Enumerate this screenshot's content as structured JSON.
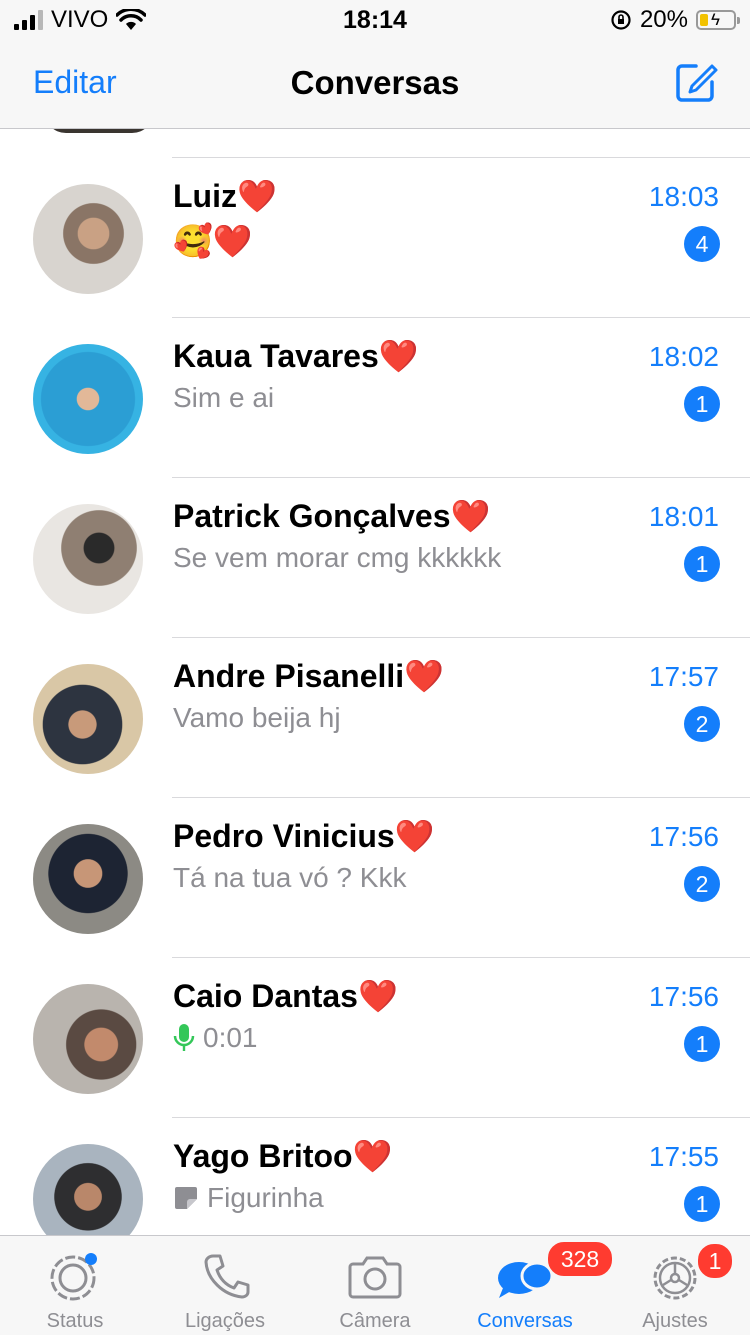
{
  "status_bar": {
    "carrier": "VIVO",
    "time": "18:14",
    "battery": "20%"
  },
  "nav": {
    "edit": "Editar",
    "title": "Conversas"
  },
  "chats": [
    {
      "name": "Luiz❤️",
      "time": "18:03",
      "preview": "🥰❤️",
      "badge": "4",
      "preview_type": "emoji"
    },
    {
      "name": "Kaua Tavares❤️",
      "time": "18:02",
      "preview": "Sim e ai",
      "badge": "1",
      "preview_type": "text"
    },
    {
      "name": "Patrick Gonçalves❤️",
      "time": "18:01",
      "preview": "Se vem morar cmg kkkkkk",
      "badge": "1",
      "preview_type": "text"
    },
    {
      "name": "Andre Pisanelli❤️",
      "time": "17:57",
      "preview": "Vamo beija hj",
      "badge": "2",
      "preview_type": "text"
    },
    {
      "name": "Pedro Vinicius❤️",
      "time": "17:56",
      "preview": "Tá na tua vó ? Kkk",
      "badge": "2",
      "preview_type": "text"
    },
    {
      "name": "Caio Dantas❤️",
      "time": "17:56",
      "preview": "0:01",
      "badge": "1",
      "preview_type": "voice"
    },
    {
      "name": "Yago Britoo❤️",
      "time": "17:55",
      "preview": "Figurinha",
      "badge": "1",
      "preview_type": "sticker"
    }
  ],
  "tabs": [
    {
      "label": "Status",
      "icon": "status-icon"
    },
    {
      "label": "Ligações",
      "icon": "phone-icon"
    },
    {
      "label": "Câmera",
      "icon": "camera-icon"
    },
    {
      "label": "Conversas",
      "icon": "chats-icon",
      "badge": "328",
      "active": true
    },
    {
      "label": "Ajustes",
      "icon": "gear-icon",
      "badge": "1"
    }
  ],
  "colors": {
    "accent": "#147efb",
    "badge_red": "#ff3b30",
    "mic_green": "#34c759"
  }
}
